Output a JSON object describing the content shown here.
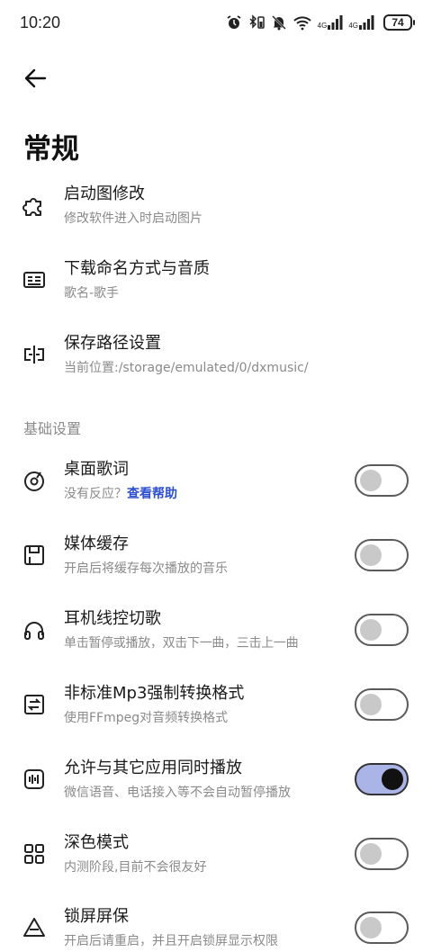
{
  "status_bar": {
    "time": "10:20",
    "network_1": "4G",
    "network_2": "4G",
    "battery": "74"
  },
  "header": {
    "title": "常规"
  },
  "general_items": [
    {
      "title": "启动图修改",
      "subtitle": "修改软件进入时启动图片",
      "icon": "puzzle-icon"
    },
    {
      "title": "下载命名方式与音质",
      "subtitle": "歌名-歌手",
      "icon": "id-card-icon"
    },
    {
      "title": "保存路径设置",
      "subtitle": "当前位置:/storage/emulated/0/dxmusic/",
      "icon": "split-path-icon"
    }
  ],
  "basic_section": {
    "header": "基础设置",
    "desktop_lyrics": {
      "title": "桌面歌词",
      "subtitle_prefix": "没有反应？",
      "help_link": "查看帮助",
      "enabled": false,
      "icon": "disc-icon"
    },
    "items": [
      {
        "title": "媒体缓存",
        "subtitle": "开启后将缓存每次播放的音乐",
        "enabled": false,
        "icon": "save-disk-icon"
      },
      {
        "title": "耳机线控切歌",
        "subtitle": "单击暂停或播放，双击下一曲，三击上一曲",
        "enabled": false,
        "icon": "headphones-icon"
      },
      {
        "title": "非标准Mp3强制转换格式",
        "subtitle": "使用FFmpeg对音频转换格式",
        "enabled": false,
        "icon": "convert-arrows-icon"
      },
      {
        "title": "允许与其它应用同时播放",
        "subtitle": "微信语音、电话接入等不会自动暂停播放",
        "enabled": true,
        "icon": "audio-wave-icon"
      },
      {
        "title": "深色模式",
        "subtitle": "内测阶段,目前不会很友好",
        "enabled": false,
        "icon": "grid-icon"
      },
      {
        "title": "锁屏屏保",
        "subtitle": "开启后请重启，并且开启锁屏显示权限",
        "enabled": false,
        "icon": "triangle-icon"
      }
    ]
  },
  "colors": {
    "accent_link": "#2d4fd0",
    "toggle_on_track": "#aab4e6",
    "toggle_off_knob": "#c9c9c9"
  }
}
